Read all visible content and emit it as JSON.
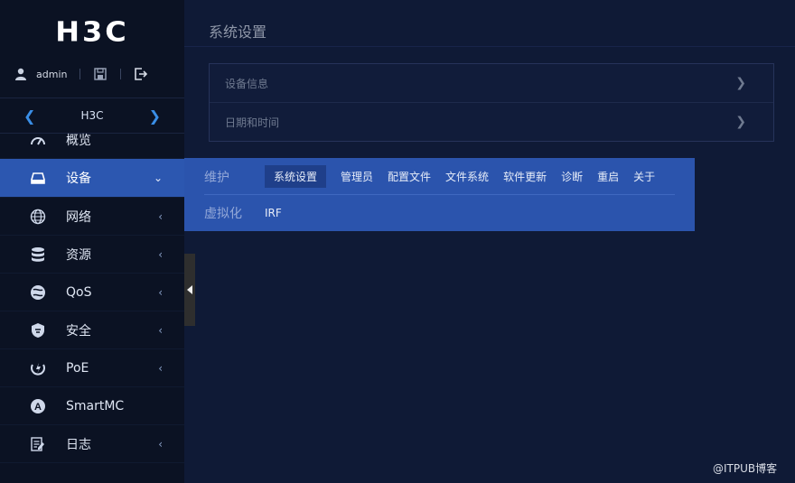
{
  "brand": {
    "logo_text": "H3C"
  },
  "user": {
    "name": "admin"
  },
  "device_switcher": {
    "label": "H3C"
  },
  "sidebar": {
    "items": [
      {
        "label": "概览",
        "icon": "dashboard-icon",
        "has_arrow": false
      },
      {
        "label": "设备",
        "icon": "device-icon",
        "has_arrow": true,
        "expanded": true,
        "active": true
      },
      {
        "label": "网络",
        "icon": "globe-icon",
        "has_arrow": true
      },
      {
        "label": "资源",
        "icon": "database-icon",
        "has_arrow": true
      },
      {
        "label": "QoS",
        "icon": "qos-icon",
        "has_arrow": true
      },
      {
        "label": "安全",
        "icon": "shield-icon",
        "has_arrow": true
      },
      {
        "label": "PoE",
        "icon": "poe-icon",
        "has_arrow": true
      },
      {
        "label": "SmartMC",
        "icon": "smartmc-icon",
        "has_arrow": false
      },
      {
        "label": "日志",
        "icon": "log-icon",
        "has_arrow": true
      }
    ]
  },
  "main": {
    "title": "系统设置",
    "rows": [
      "设备信息",
      "日期和时间"
    ]
  },
  "dropdown": {
    "row1_category": "维护",
    "row1_items": [
      "系统设置",
      "管理员",
      "配置文件",
      "文件系统",
      "软件更新",
      "诊断",
      "重启",
      "关于"
    ],
    "row1_selected": "系统设置",
    "row2_category": "虚拟化",
    "row2_items": [
      "IRF"
    ]
  },
  "watermark": "@ITPUB博客",
  "colors": {
    "sidebar_bg": "#0b1223",
    "main_bg": "#0f1a36",
    "accent": "#2c57b0",
    "chevron": "#3a8ee6"
  }
}
